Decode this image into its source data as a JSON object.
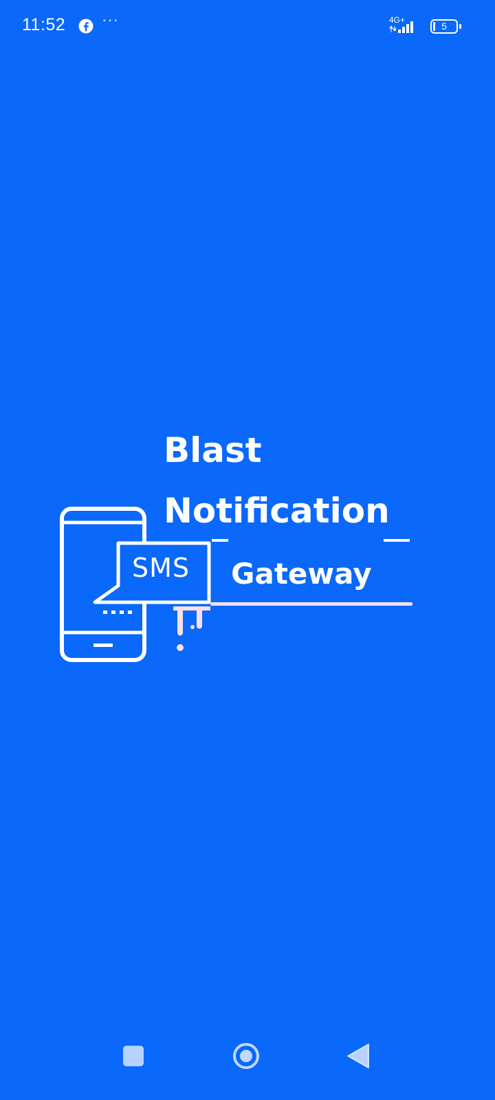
{
  "status_bar": {
    "time": "11:52",
    "notification_icon": "facebook-icon",
    "more_indicator": "···",
    "network_type": "4G+",
    "battery_level": "5"
  },
  "splash": {
    "logo_line1": "Blast",
    "logo_line2": "Notification",
    "logo_line3": "Gateway",
    "logo_badge": "SMS",
    "background_color": "#0a68fb"
  },
  "nav_bar": {
    "recent_icon": "square-icon",
    "home_icon": "circle-icon",
    "back_icon": "triangle-back-icon"
  }
}
